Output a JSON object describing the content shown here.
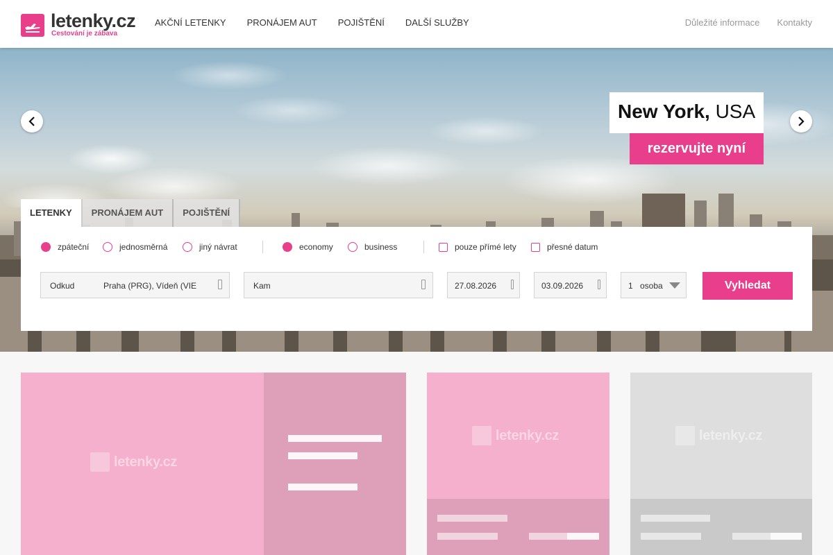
{
  "colors": {
    "accent": "#e83e8c",
    "card_pink": "#f4b0cc",
    "card_pink_dark": "#dea0b8",
    "card_grey": "#dedede"
  },
  "logo": {
    "name": "letenky.cz",
    "tagline": "Cestování je zábava",
    "icon": "airplane-icon"
  },
  "nav": {
    "items": [
      "AKČNÍ LETENKY",
      "PRONÁJEM AUT",
      "POJIŠTĚNÍ",
      "DALŠÍ SLUŽBY"
    ],
    "right": [
      "Důležité informace",
      "Kontakty"
    ]
  },
  "hero": {
    "city": "New York,",
    "country": "USA",
    "cta": "rezervujte nyní",
    "prev_icon": "chevron-left-icon",
    "next_icon": "chevron-right-icon"
  },
  "search": {
    "tabs": [
      "LETENKY",
      "PRONÁJEM AUT",
      "POJIŠTĚNÍ"
    ],
    "active_tab": "LETENKY",
    "trip_options": [
      {
        "label": "zpáteční",
        "selected": true
      },
      {
        "label": "jednosměrná",
        "selected": false
      },
      {
        "label": "jiný návrat",
        "selected": false
      }
    ],
    "class_options": [
      {
        "label": "economy",
        "selected": true
      },
      {
        "label": "business",
        "selected": false
      }
    ],
    "checkboxes": [
      {
        "label": "pouze přímé lety",
        "checked": false
      },
      {
        "label": "přesné datum",
        "checked": false
      }
    ],
    "from_label": "Odkud",
    "from_value": "Praha (PRG), Vídeň (VIE",
    "to_label": "Kam",
    "depart_date": "27.08.2026",
    "return_date": "03.09.2026",
    "passengers_count": "1",
    "passengers_unit": "osoba",
    "search_button": "Vyhledat"
  },
  "placeholder_logo": "letenky.cz"
}
